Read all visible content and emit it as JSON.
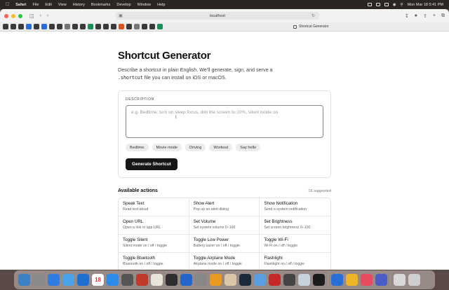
{
  "menubar": {
    "app": "Safari",
    "items": [
      "File",
      "Edit",
      "View",
      "History",
      "Bookmarks",
      "Develop",
      "Window",
      "Help"
    ],
    "clock": "Mon Mar 18  5:41 PM"
  },
  "browser": {
    "url": "localhost",
    "tab_title": "Shortcut Generator"
  },
  "page": {
    "title": "Shortcut Generator",
    "subtitle_before": "Describe a shortcut in plain English. We'll generate, sign, and serve a",
    "subtitle_code": ".shortcut",
    "subtitle_after": " file you can install on iOS or macOS.",
    "description_label": "DESCRIPTION",
    "description_placeholder": "e.g. Bedtime: turn on sleep focus, dim the screen to 10%, silent mode on",
    "chips": [
      "Bedtime",
      "Movie mode",
      "Driving",
      "Workout",
      "Say hello"
    ],
    "generate_label": "Generate Shortcut",
    "actions_title": "Available actions",
    "actions_count": "16 supported",
    "actions": [
      {
        "name": "Speak Text",
        "desc": "Read text aloud"
      },
      {
        "name": "Show Alert",
        "desc": "Pop up an alert dialog"
      },
      {
        "name": "Show Notification",
        "desc": "Send a system notification"
      },
      {
        "name": "Open URL",
        "desc": "Open a link or app URL"
      },
      {
        "name": "Set Volume",
        "desc": "Set system volume 0–100"
      },
      {
        "name": "Set Brightness",
        "desc": "Set screen brightness 0–100"
      },
      {
        "name": "Toggle Silent",
        "desc": "Silent mode on / off / toggle"
      },
      {
        "name": "Toggle Low Power",
        "desc": "Battery saver on / off / toggle"
      },
      {
        "name": "Toggle Wi-Fi",
        "desc": "Wi-Fi on / off / toggle"
      },
      {
        "name": "Toggle Bluetooth",
        "desc": "Bluetooth on / off / toggle"
      },
      {
        "name": "Toggle Airplane Mode",
        "desc": "Airplane mode on / off / toggle"
      },
      {
        "name": "Flashlight",
        "desc": "Flashlight on / off / toggle"
      }
    ]
  },
  "dock": {
    "calendar_day": "18"
  }
}
